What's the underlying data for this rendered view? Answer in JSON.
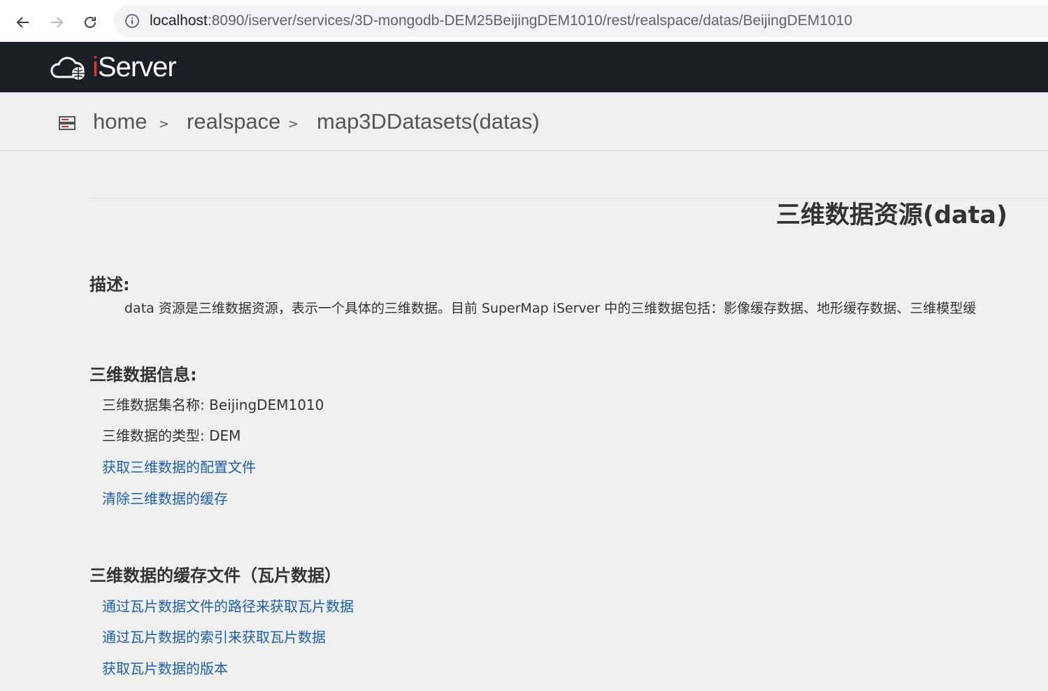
{
  "browser": {
    "url_host": "localhost",
    "url_rest": ":8090/iserver/services/3D-mongodb-DEM25BeijingDEM1010/rest/realspace/datas/BeijingDEM1010"
  },
  "header": {
    "logo_prefix": "i",
    "logo_rest": "Server"
  },
  "breadcrumb": {
    "items": [
      "home",
      "realspace",
      "map3DDatasets(datas)"
    ],
    "separator": ">"
  },
  "page": {
    "title": "三维数据资源(data)",
    "description_heading": "描述:",
    "description_text": "data 资源是三维数据资源，表示一个具体的三维数据。目前 SuperMap iServer 中的三维数据包括：影像缓存数据、地形缓存数据、三维模型缓",
    "info_heading": "三维数据信息:",
    "info": {
      "name_label": "三维数据集名称:",
      "name_value": "BeijingDEM1010",
      "type_label": "三维数据的类型:",
      "type_value": "DEM"
    },
    "info_links": [
      "获取三维数据的配置文件",
      "清除三维数据的缓存"
    ],
    "cache_heading": "三维数据的缓存文件（瓦片数据）",
    "cache_links": [
      "通过瓦片数据文件的路径来获取瓦片数据",
      "通过瓦片数据的索引来获取瓦片数据",
      "获取瓦片数据的版本"
    ]
  },
  "colors": {
    "link": "#1a5fb4",
    "header_bg": "#1a1e26",
    "page_bg": "#f0f0f0"
  }
}
